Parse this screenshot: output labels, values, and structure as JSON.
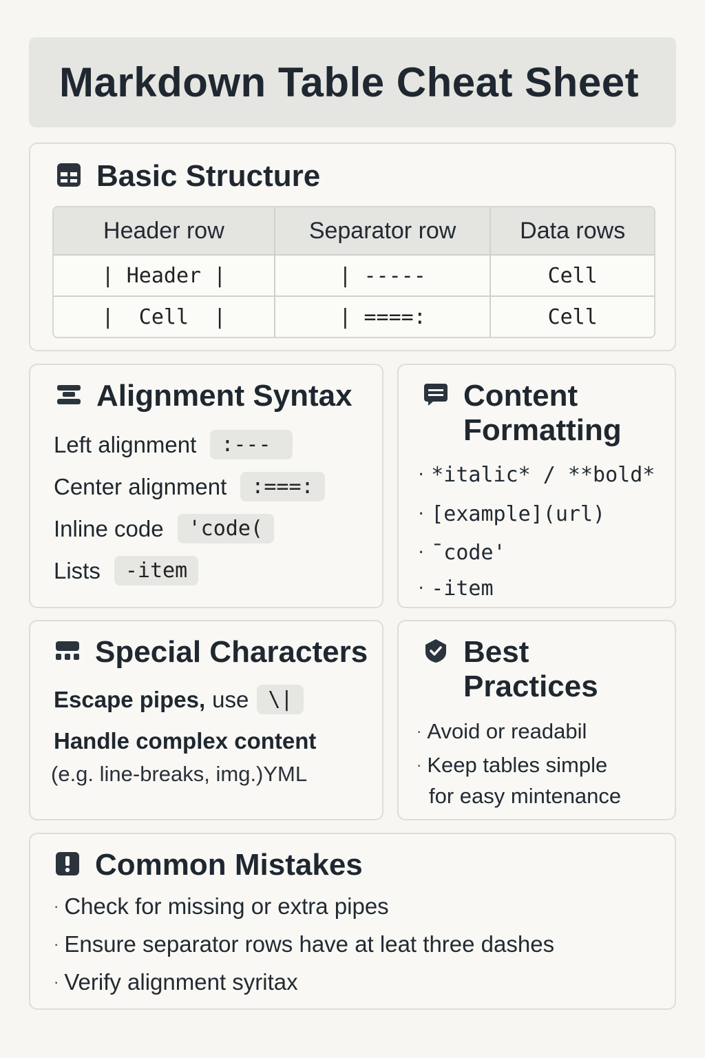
{
  "title": "Markdown Table Cheat Sheet",
  "basic": {
    "heading": "Basic Structure",
    "icon": "table-icon",
    "headers": [
      "Header row",
      "Separator row",
      "Data rows"
    ],
    "rows": [
      [
        "| Header |",
        "| -----",
        "Cell"
      ],
      [
        "|  Cell  |",
        "| ====:",
        "Cell"
      ]
    ]
  },
  "alignment": {
    "heading": "Alignment Syntax",
    "icon": "align-icon",
    "items": [
      {
        "label": "Left alignment",
        "code": ":---"
      },
      {
        "label": "Center alignment",
        "code": ":===:"
      },
      {
        "label": "Inline code",
        "code": "'code("
      },
      {
        "label": "Lists",
        "code": "-item"
      }
    ]
  },
  "content": {
    "heading_line1": "Content",
    "heading_line2": "Formatting",
    "icon": "message-icon",
    "items": [
      "*italic* / **bold*",
      "[example](url)",
      "¯code'",
      "-item"
    ]
  },
  "special": {
    "heading": "Special Characters",
    "icon": "keyboard-icon",
    "escape_label": "Escape pipes,",
    "escape_use": "use",
    "escape_code": "\\|",
    "complex_label": "Handle complex content",
    "complex_note": "(e.g. line-breaks, img.)YML"
  },
  "best": {
    "heading_line1": "Best",
    "heading_line2": "Practices",
    "icon": "check-shield-icon",
    "item1": "Avoid or readabil",
    "item2_line1": "Keep tables simple",
    "item2_line2": "for easy mintenance"
  },
  "mistakes": {
    "heading": "Common Mistakes",
    "icon": "exclamation-icon",
    "items": [
      "Check for missing or extra pipes",
      "Ensure separator rows have at leat three dashes",
      "Verify alignment syritax"
    ]
  },
  "colors": {
    "background": "#f7f6f1",
    "title_bg": "#e5e5e2",
    "text": "#1f2730",
    "chip_bg": "#e6e6e3",
    "border": "#deddd8"
  }
}
